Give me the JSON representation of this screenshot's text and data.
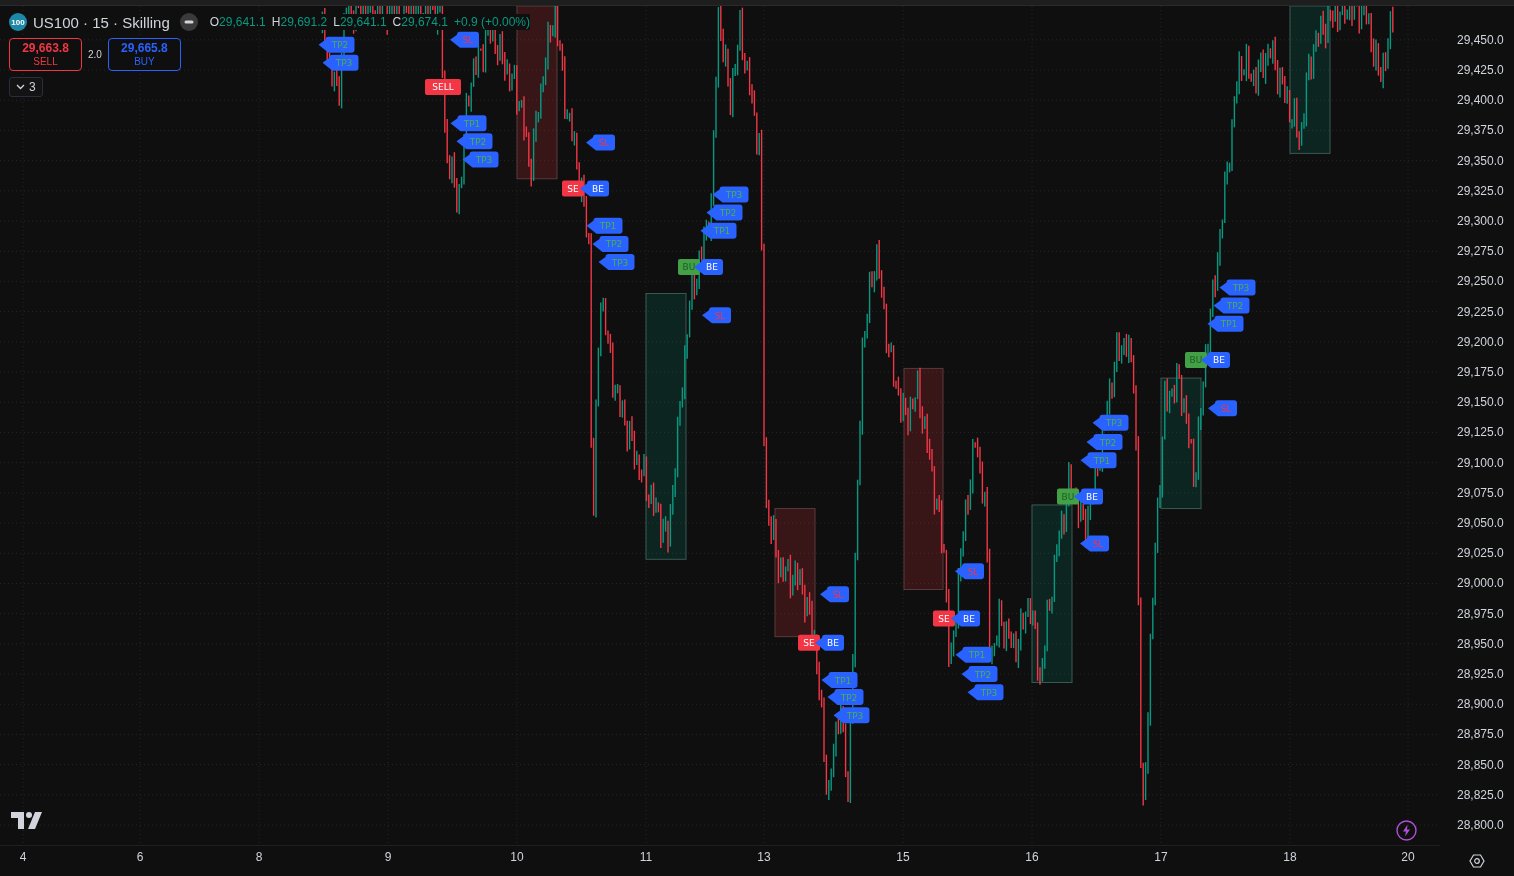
{
  "header": {
    "logo": "100",
    "title": "US100 · 15 · Skilling",
    "ohlc": [
      {
        "label": "O",
        "value": "29,641.1"
      },
      {
        "label": "H",
        "value": "29,691.2"
      },
      {
        "label": "L",
        "value": "29,641.1"
      },
      {
        "label": "C",
        "value": "29,674.1"
      }
    ],
    "change": "+0.9 (+0.00%)"
  },
  "trade": {
    "sell": {
      "price": "29,663.8",
      "label": "SELL"
    },
    "quantity": "2.0",
    "buy": {
      "price": "29,665.8",
      "label": "BUY"
    }
  },
  "indicators_toggle": {
    "count": "3"
  },
  "chart": {
    "zones": [
      {
        "kind": "sell"
      },
      {
        "kind": "sell"
      },
      {
        "kind": "sell"
      },
      {
        "kind": "buy"
      },
      {
        "kind": "buy"
      },
      {
        "kind": "buy"
      },
      {
        "kind": "buy"
      }
    ],
    "markers": [
      {
        "kind": "tp",
        "text": "TP2"
      },
      {
        "kind": "tp",
        "text": "TP3"
      },
      {
        "kind": "sl",
        "text": "SL"
      },
      {
        "kind": "sell",
        "text": "SELL"
      },
      {
        "kind": "tp",
        "text": "TP1"
      },
      {
        "kind": "tp",
        "text": "TP2"
      },
      {
        "kind": "tp",
        "text": "TP3"
      },
      {
        "kind": "sl",
        "text": "SL"
      },
      {
        "kind": "sell",
        "text": "SE"
      },
      {
        "kind": "be",
        "text": "BE"
      },
      {
        "kind": "tp",
        "text": "TP1"
      },
      {
        "kind": "tp",
        "text": "TP2"
      },
      {
        "kind": "tp",
        "text": "TP3"
      },
      {
        "kind": "tp",
        "text": "TP3"
      },
      {
        "kind": "tp",
        "text": "TP2"
      },
      {
        "kind": "tp",
        "text": "TP1"
      },
      {
        "kind": "buy",
        "text": "BU"
      },
      {
        "kind": "be",
        "text": "BE"
      },
      {
        "kind": "sl",
        "text": "SL"
      },
      {
        "kind": "sl",
        "text": "SL"
      },
      {
        "kind": "sell",
        "text": "SE"
      },
      {
        "kind": "be",
        "text": "BE"
      },
      {
        "kind": "tp",
        "text": "TP1"
      },
      {
        "kind": "tp",
        "text": "TP2"
      },
      {
        "kind": "tp",
        "text": "TP3"
      },
      {
        "kind": "sl",
        "text": "SL"
      },
      {
        "kind": "sell",
        "text": "SE"
      },
      {
        "kind": "be",
        "text": "BE"
      },
      {
        "kind": "tp",
        "text": "TP1"
      },
      {
        "kind": "tp",
        "text": "TP2"
      },
      {
        "kind": "tp",
        "text": "TP3"
      },
      {
        "kind": "tp",
        "text": "TP3"
      },
      {
        "kind": "tp",
        "text": "TP2"
      },
      {
        "kind": "tp",
        "text": "TP1"
      },
      {
        "kind": "buy",
        "text": "BU"
      },
      {
        "kind": "be",
        "text": "BE"
      },
      {
        "kind": "sl",
        "text": "SL"
      },
      {
        "kind": "tp",
        "text": "TP3"
      },
      {
        "kind": "tp",
        "text": "TP2"
      },
      {
        "kind": "tp",
        "text": "TP1"
      },
      {
        "kind": "buy",
        "text": "BU"
      },
      {
        "kind": "be",
        "text": "BE"
      },
      {
        "kind": "sl",
        "text": "SL"
      }
    ]
  },
  "price_axis": {
    "labels": [
      "29,450.0",
      "29,425.0",
      "29,400.0",
      "29,375.0",
      "29,350.0",
      "29,325.0",
      "29,300.0",
      "29,275.0",
      "29,250.0",
      "29,225.0",
      "29,200.0",
      "29,175.0",
      "29,150.0",
      "29,125.0",
      "29,100.0",
      "29,075.0",
      "29,050.0",
      "29,025.0",
      "29,000.0",
      "28,975.0",
      "28,950.0",
      "28,925.0",
      "28,900.0",
      "28,875.0",
      "28,850.0",
      "28,825.0",
      "28,800.0"
    ]
  },
  "time_axis": {
    "labels": [
      "4",
      "6",
      "8",
      "9",
      "10",
      "11",
      "13",
      "15",
      "16",
      "17",
      "18",
      "20"
    ]
  }
}
